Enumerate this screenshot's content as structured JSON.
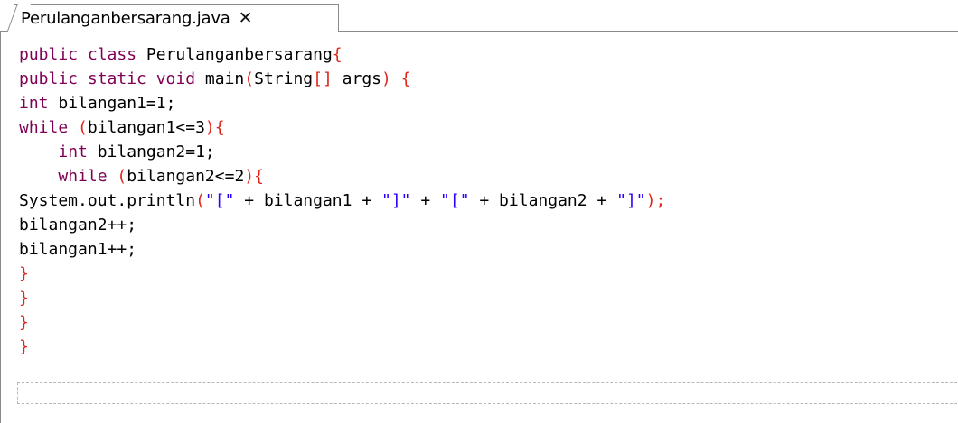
{
  "tab": {
    "filename": "Perulanganbersarang.java",
    "close_glyph": "✕",
    "close_icon": "close-icon"
  },
  "editor": {
    "lines": [
      [
        {
          "t": "public class ",
          "c": "kw"
        },
        {
          "t": "Perulanganbersarang",
          "c": "plain"
        },
        {
          "t": "{",
          "c": "brace"
        }
      ],
      [
        {
          "t": "public static void ",
          "c": "kw"
        },
        {
          "t": "main",
          "c": "plain"
        },
        {
          "t": "(",
          "c": "brace"
        },
        {
          "t": "String",
          "c": "plain"
        },
        {
          "t": "[]",
          "c": "brace"
        },
        {
          "t": " args",
          "c": "plain"
        },
        {
          "t": ") {",
          "c": "brace"
        }
      ],
      [
        {
          "t": "int ",
          "c": "kw"
        },
        {
          "t": "bilangan1=1;",
          "c": "plain"
        }
      ],
      [
        {
          "t": "while ",
          "c": "kw"
        },
        {
          "t": "(",
          "c": "brace"
        },
        {
          "t": "bilangan1<=3",
          "c": "plain"
        },
        {
          "t": "){",
          "c": "brace"
        }
      ],
      [
        {
          "t": "    ",
          "c": "plain"
        },
        {
          "t": "int ",
          "c": "kw"
        },
        {
          "t": "bilangan2=1;",
          "c": "plain"
        }
      ],
      [
        {
          "t": "    ",
          "c": "plain"
        },
        {
          "t": "while ",
          "c": "kw"
        },
        {
          "t": "(",
          "c": "brace"
        },
        {
          "t": "bilangan2<=2",
          "c": "plain"
        },
        {
          "t": "){",
          "c": "brace"
        }
      ],
      [
        {
          "t": "System.out.println",
          "c": "plain"
        },
        {
          "t": "(",
          "c": "brace"
        },
        {
          "t": "\"[\"",
          "c": "str"
        },
        {
          "t": " + bilangan1 + ",
          "c": "plain"
        },
        {
          "t": "\"]\"",
          "c": "str"
        },
        {
          "t": " + ",
          "c": "plain"
        },
        {
          "t": "\"[\"",
          "c": "str"
        },
        {
          "t": " + bilangan2 + ",
          "c": "plain"
        },
        {
          "t": "\"]\"",
          "c": "str"
        },
        {
          "t": ");",
          "c": "brace"
        }
      ],
      [
        {
          "t": "bilangan2++;",
          "c": "plain"
        }
      ],
      [
        {
          "t": "bilangan1++;",
          "c": "plain"
        }
      ],
      [
        {
          "t": "}",
          "c": "brace"
        }
      ],
      [
        {
          "t": "}",
          "c": "brace"
        }
      ],
      [
        {
          "t": "}",
          "c": "brace"
        }
      ],
      [
        {
          "t": "}",
          "c": "brace"
        }
      ]
    ]
  },
  "colors": {
    "keyword": "#7f0055",
    "brace": "#e0241b",
    "string": "#2a00ff",
    "border": "#8a8a8a"
  }
}
